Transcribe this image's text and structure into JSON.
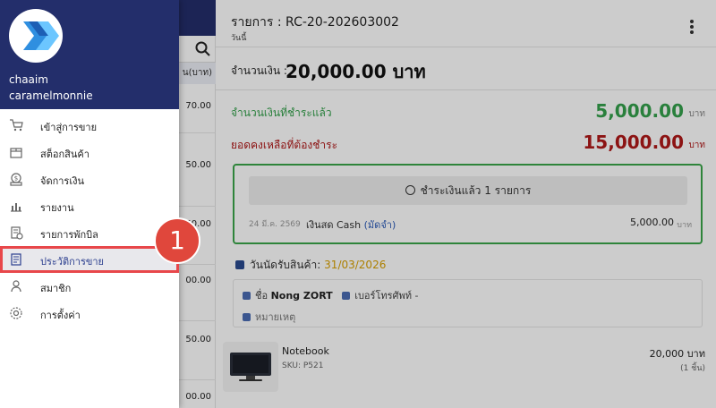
{
  "drawer": {
    "user_name": "chaaim",
    "user_shop": "caramelmonnie",
    "items": [
      {
        "label": "เข้าสู่การขาย",
        "icon": "cart-icon"
      },
      {
        "label": "สต็อกสินค้า",
        "icon": "box-icon"
      },
      {
        "label": "จัดการเงิน",
        "icon": "money-icon"
      },
      {
        "label": "รายงาน",
        "icon": "chart-icon"
      },
      {
        "label": "รายการพักบิล",
        "icon": "bill-icon"
      },
      {
        "label": "ประวัติการขาย",
        "icon": "history-icon",
        "active": true
      },
      {
        "label": "สมาชิก",
        "icon": "person-icon"
      },
      {
        "label": "การตั้งค่า",
        "icon": "gear-icon"
      }
    ],
    "step_badge": "1"
  },
  "list": {
    "column_header": "น(บาท)",
    "amounts": [
      "70.00",
      "50.00",
      "50.00",
      "00.00",
      "50.00",
      "00.00"
    ]
  },
  "detail": {
    "title": "รายการ : RC-20-202603002",
    "subtitle": "วันนี้",
    "amount_label": "จำนวนเงิน :",
    "amount_value": "20,000.00 บาท",
    "paid_label": "จำนวนเงินที่ชำระแล้ว",
    "paid_value": "5,000.00",
    "paid_unit": "บาท",
    "remain_label": "ยอดคงเหลือที่ต้องชำระ",
    "remain_value": "15,000.00",
    "remain_unit": "บาท",
    "payment": {
      "header": "ชำระเงินแล้ว 1 รายการ",
      "date": "24 มี.ค. 2569",
      "method": "เงินสด Cash",
      "tag": "(มัดจำ)",
      "amount": "5,000.00",
      "unit": "บาท"
    },
    "pickup_label": "วันนัดรับสินค้า:",
    "pickup_date": "31/03/2026",
    "customer": {
      "name_label": "ชื่อ",
      "name": "Nong ZORT",
      "phone_label": "เบอร์โทรศัพท์ -",
      "note_label": "หมายเหตุ"
    },
    "product": {
      "name": "Notebook",
      "sku": "SKU: P521",
      "price": "20,000 บาท",
      "qty": "(1 ชิ้น)"
    }
  }
}
